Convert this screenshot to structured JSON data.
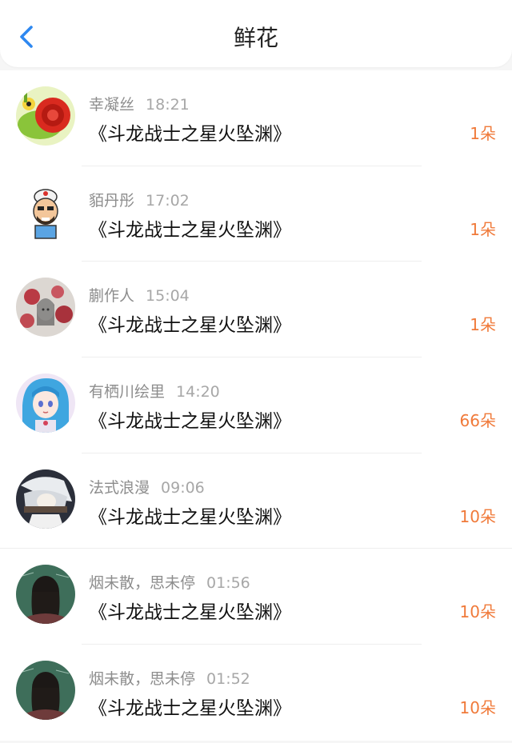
{
  "header": {
    "title": "鲜花",
    "back_icon": "chevron-left-icon"
  },
  "colors": {
    "accent_blue": "#2e88f0",
    "count_orange": "#f07a3a",
    "name_gray": "#8d8d8d"
  },
  "items": [
    {
      "name": "幸凝丝",
      "time": "18:21",
      "book": "《斗龙战士之星火坠渊》",
      "count": "1朵",
      "avatar": "avatar-snail"
    },
    {
      "name": "貊丹彤",
      "time": "17:02",
      "book": "《斗龙战士之星火坠渊》",
      "count": "1朵",
      "avatar": "avatar-cartoon-man"
    },
    {
      "name": "蒯作人",
      "time": "15:04",
      "book": "《斗龙战士之星火坠渊》",
      "count": "1朵",
      "avatar": "avatar-flowers"
    },
    {
      "name": "有栖川绘里",
      "time": "14:20",
      "book": "《斗龙战士之星火坠渊》",
      "count": "66朵",
      "avatar": "avatar-anime-girl"
    },
    {
      "name": "法式浪漫",
      "time": "09:06",
      "book": "《斗龙战士之星火坠渊》",
      "count": "10朵",
      "avatar": "avatar-anime-white-hair"
    },
    {
      "name": "烟未散，思未停",
      "time": "01:56",
      "book": "《斗龙战士之星火坠渊》",
      "count": "10朵",
      "avatar": "avatar-girl-back"
    },
    {
      "name": "烟未散，思未停",
      "time": "01:52",
      "book": "《斗龙战士之星火坠渊》",
      "count": "10朵",
      "avatar": "avatar-girl-back"
    }
  ]
}
